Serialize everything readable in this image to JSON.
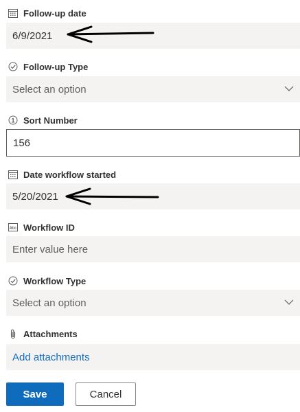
{
  "form": {
    "follow_up_date": {
      "label": "Follow-up date",
      "value": "6/9/2021",
      "icon": "calendar-icon"
    },
    "follow_up_type": {
      "label": "Follow-up Type",
      "placeholder": "Select an option",
      "icon": "check-circle-icon"
    },
    "sort_number": {
      "label": "Sort Number",
      "value": "156",
      "icon": "number-circle-icon"
    },
    "date_workflow_started": {
      "label": "Date workflow started",
      "value": "5/20/2021",
      "icon": "calendar-icon"
    },
    "workflow_id": {
      "label": "Workflow ID",
      "placeholder": "Enter value here",
      "icon": "text-field-icon"
    },
    "workflow_type": {
      "label": "Workflow Type",
      "placeholder": "Select an option",
      "icon": "check-circle-icon"
    },
    "attachments": {
      "label": "Attachments",
      "link": "Add attachments",
      "icon": "paperclip-icon"
    }
  },
  "actions": {
    "save_label": "Save",
    "cancel_label": "Cancel"
  },
  "colors": {
    "accent": "#0f6cbd",
    "field_bg": "#f5f3f2",
    "text": "#323130"
  }
}
